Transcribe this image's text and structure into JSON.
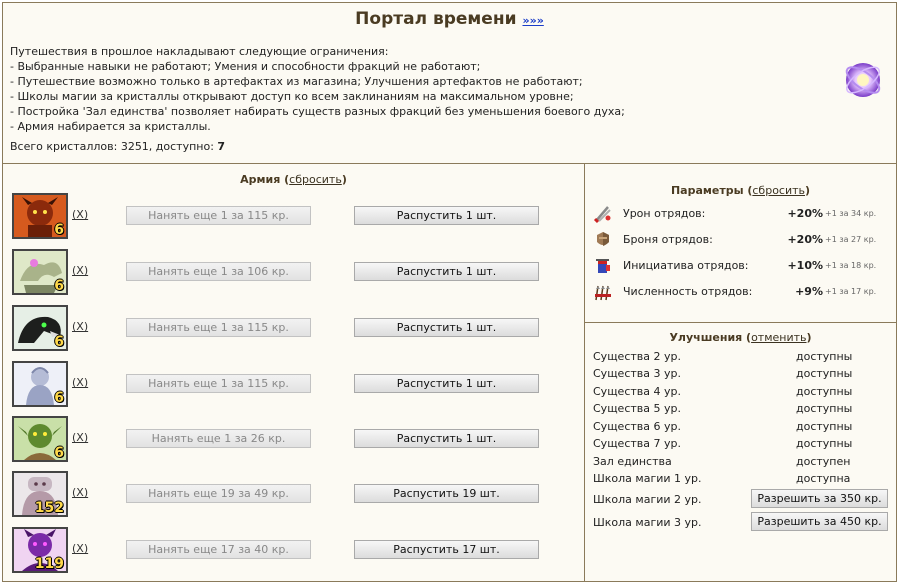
{
  "header": {
    "title": "Портал времени",
    "link": "»»»",
    "description": [
      "Путешествия в прошлое накладывают следующие ограничения:",
      "- Выбранные навыки не работают; Умения и способности фракций не работают;",
      "- Путешествие возможно только в артефактах из магазина; Улучшения артефактов не работают;",
      "- Школы магии за кристаллы открывают доступ ко всем заклинаниям на максимальном уровне;",
      "- Постройка 'Зал единства' позволяет набирать существ разных фракций без уменьшения боевого духа;",
      "- Армия набирается за кристаллы."
    ],
    "crystals_label": "Всего кристаллов: 3251, доступно: ",
    "crystals_available": "7"
  },
  "army": {
    "title": "Армия",
    "reset": "сбросить",
    "remove_label": "(X)",
    "units": [
      {
        "count": "6",
        "hire": "Нанять еще 1 за 115 кр.",
        "dismiss": "Распустить 1 шт."
      },
      {
        "count": "6",
        "hire": "Нанять еще 1 за 106 кр.",
        "dismiss": "Распустить 1 шт."
      },
      {
        "count": "6",
        "hire": "Нанять еще 1 за 115 кр.",
        "dismiss": "Распустить 1 шт."
      },
      {
        "count": "6",
        "hire": "Нанять еще 1 за 115 кр.",
        "dismiss": "Распустить 1 шт."
      },
      {
        "count": "6",
        "hire": "Нанять еще 1 за 26 кр.",
        "dismiss": "Распустить 1 шт."
      },
      {
        "count": "152",
        "hire": "Нанять еще 19 за 49 кр.",
        "dismiss": "Распустить 19 шт."
      },
      {
        "count": "119",
        "hire": "Нанять еще 17 за 40 кр.",
        "dismiss": "Распустить 17 шт."
      }
    ]
  },
  "params": {
    "title": "Параметры",
    "reset": "сбросить",
    "rows": [
      {
        "name": "Урон отрядов:",
        "value": "+20%",
        "next": "+1 за 34 кр.",
        "icon": "swords-icon"
      },
      {
        "name": "Броня отрядов:",
        "value": "+20%",
        "next": "+1 за 27 кр.",
        "icon": "armor-icon"
      },
      {
        "name": "Инициатива отрядов:",
        "value": "+10%",
        "next": "+1 за 18 кр.",
        "icon": "initiative-icon"
      },
      {
        "name": "Численность отрядов:",
        "value": "+9%",
        "next": "+1 за 17 кр.",
        "icon": "troops-icon"
      }
    ]
  },
  "upgrades": {
    "title": "Улучшения",
    "cancel": "отменить",
    "rows": [
      {
        "name": "Существа 2 ур.",
        "status": "доступны"
      },
      {
        "name": "Существа 3 ур.",
        "status": "доступны"
      },
      {
        "name": "Существа 4 ур.",
        "status": "доступны"
      },
      {
        "name": "Существа 5 ур.",
        "status": "доступны"
      },
      {
        "name": "Существа 6 ур.",
        "status": "доступны"
      },
      {
        "name": "Существа 7 ур.",
        "status": "доступны"
      },
      {
        "name": "Зал единства",
        "status": "доступен"
      },
      {
        "name": "Школа магии 1 ур.",
        "status": "доступна"
      },
      {
        "name": "Школа магии 2 ур.",
        "button": "Разрешить за 350 кр."
      },
      {
        "name": "Школа магии 3 ур.",
        "button": "Разрешить за 450 кр."
      }
    ]
  }
}
